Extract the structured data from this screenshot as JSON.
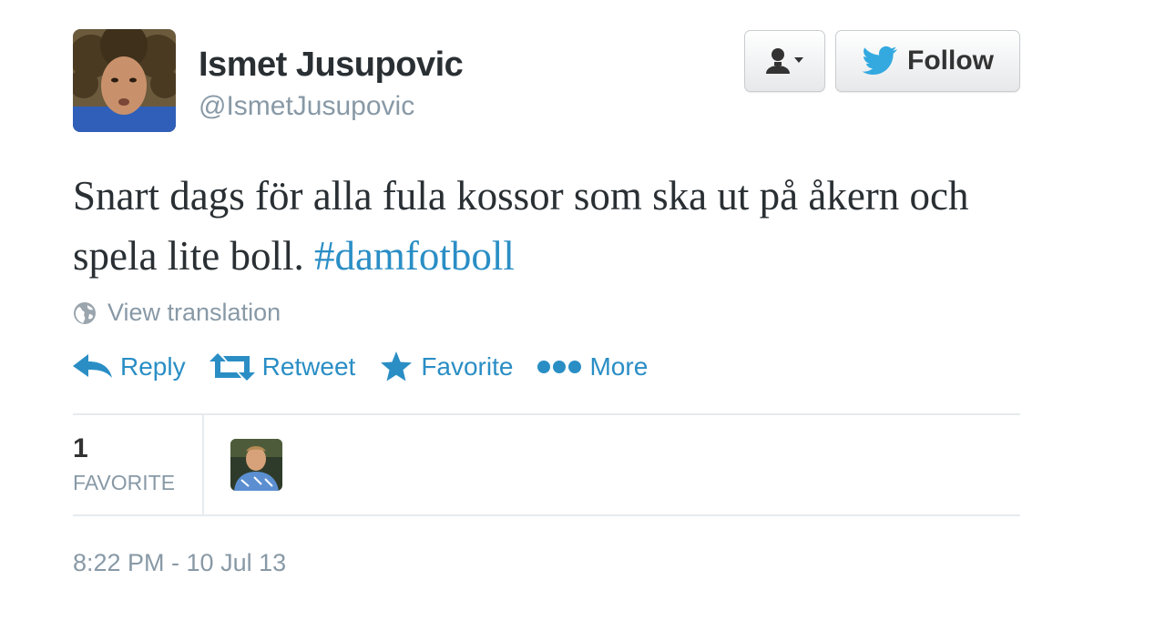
{
  "user": {
    "display_name": "Ismet Jusupovic",
    "screen_name": "@IsmetJusupovic"
  },
  "buttons": {
    "user_menu_icon": "user-dropdown-icon",
    "follow_label": "Follow",
    "follow_icon": "twitter-bird-icon"
  },
  "tweet": {
    "text": "Snart dags för alla fula kossor som ska ut på åkern och spela lite boll.",
    "hashtag": "#damfotboll"
  },
  "translation": {
    "label": "View translation",
    "icon": "globe-icon"
  },
  "actions": {
    "reply": "Reply",
    "retweet": "Retweet",
    "favorite": "Favorite",
    "more": "More"
  },
  "stats": {
    "favorite_count": "1",
    "favorite_label": "FAVORITE"
  },
  "timestamp": "8:22 PM - 10 Jul 13",
  "colors": {
    "link": "#2a8ec5",
    "muted": "#8899a6",
    "text": "#292f33"
  }
}
